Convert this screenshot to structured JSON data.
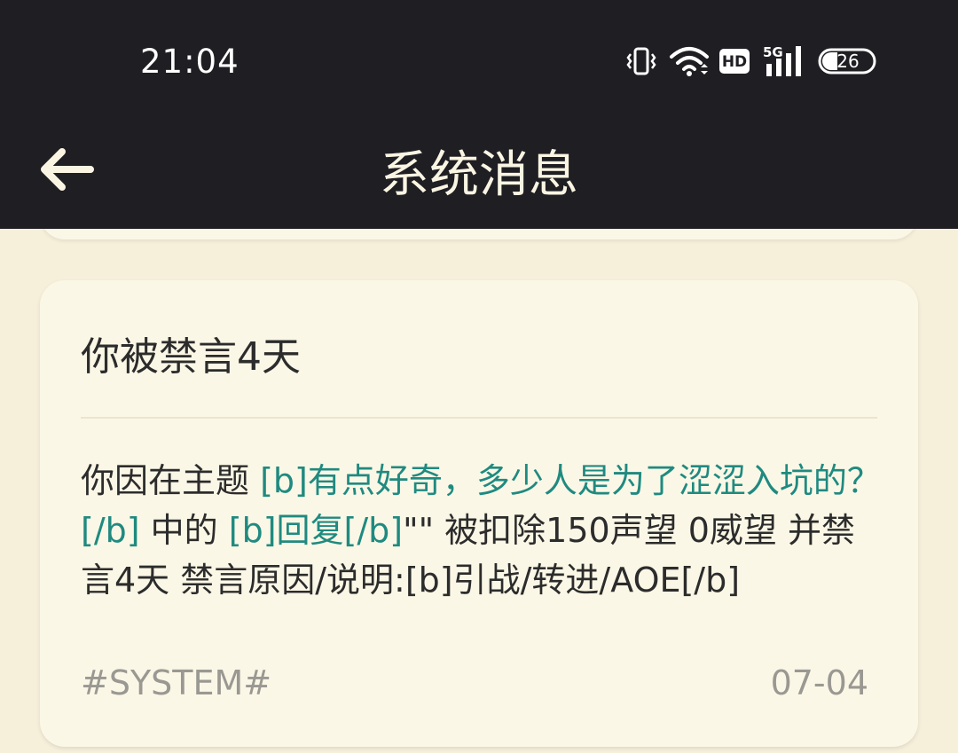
{
  "status_bar": {
    "time": "21:04",
    "battery": "26",
    "network": "5G",
    "hd_label": "HD",
    "icons": [
      "vibrate-icon",
      "wifi-icon",
      "hd-icon",
      "signal-5g-icon",
      "battery-icon"
    ]
  },
  "toolbar": {
    "back_icon": "arrow-left-icon",
    "title": "系统消息"
  },
  "message": {
    "title": "你被禁言4天",
    "body": {
      "prefix": "你因在主题 ",
      "topic_link": "[b]有点好奇，多少人是为了涩涩入坑的？[/b]",
      "middle": " 中的 ",
      "reply_link": "[b]回复[/b]",
      "suffix": "\"\" 被扣除150声望 0威望 并禁言4天 禁言原因/说明:[b]引战/转进/AOE[/b]"
    },
    "sender": "#SYSTEM#",
    "date": "07-04"
  },
  "colors": {
    "bar_bg": "#1f1e23",
    "page_bg": "#f6f0db",
    "card_bg": "#fbf7e6",
    "link": "#1f8a80",
    "meta_text": "#9a9892"
  }
}
